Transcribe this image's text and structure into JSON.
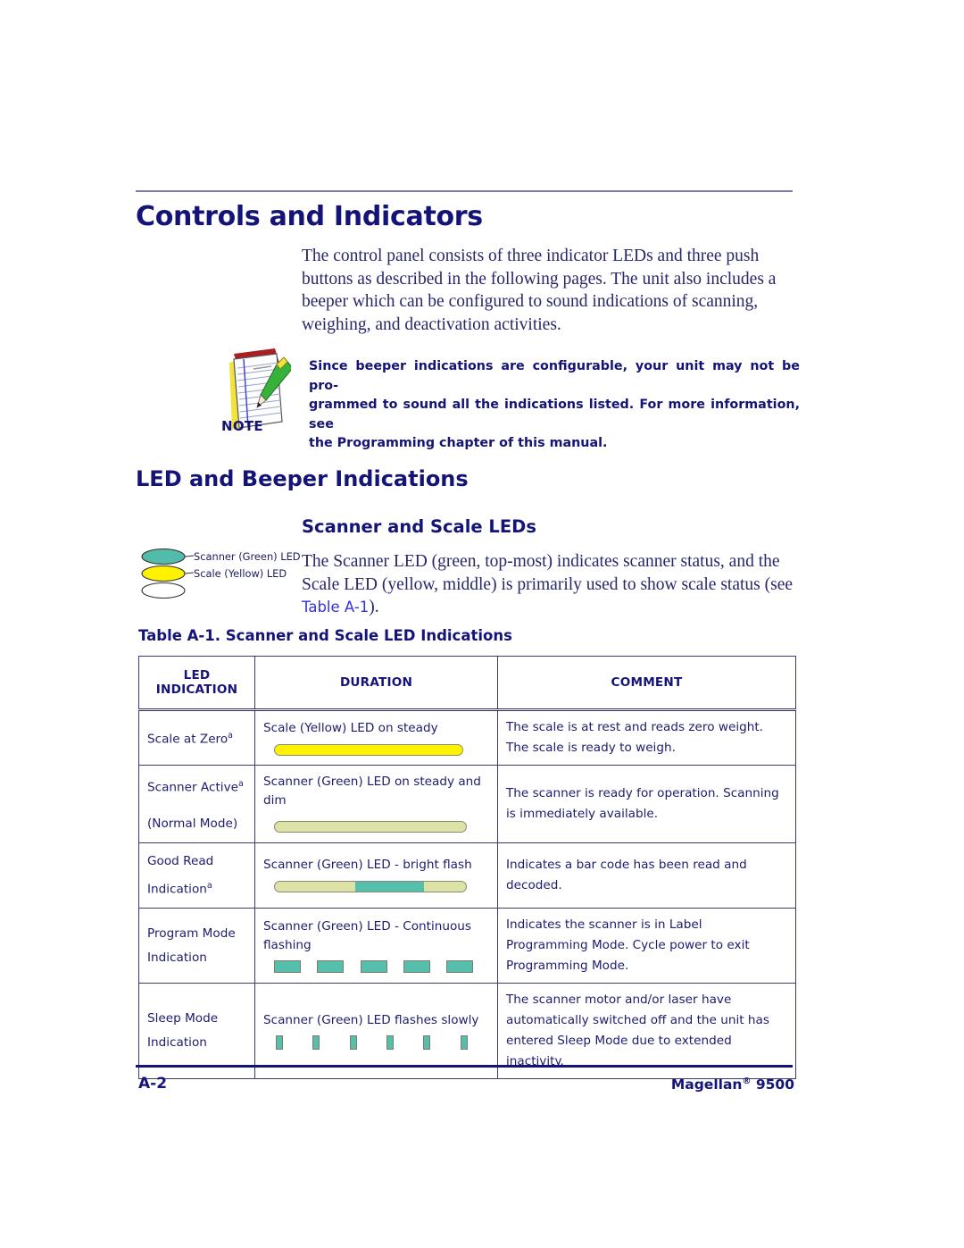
{
  "page": {
    "heading": "Controls and Indicators",
    "intro_paragraph": "The control panel consists of three indicator LEDs and three push buttons as described in the following pages. The unit also includes a beeper which can be configured to sound indications of scanning, weighing, and deactivation activities.",
    "rule_color": "#7a7ab0",
    "heading_color": "#141478"
  },
  "note": {
    "label": "NOTE",
    "icon": "notepad-pencil-icon",
    "line1": "Since beeper indications are configurable, your unit may not be pro-",
    "line2": "grammed to sound all the indications listed. For more information, see",
    "line3": "the Programming  chapter of this manual."
  },
  "sections": {
    "h2": "LED and Beeper Indications",
    "h3": "Scanner and Scale LEDs",
    "paragraph_part1": "The Scanner LED (green, top-most) indicates scanner status, and the Scale LED (yellow, middle) is primarily used to show scale status (see ",
    "paragraph_link": "Table A-1",
    "paragraph_part2": ")."
  },
  "led_figure": {
    "leds": [
      {
        "name": "scanner-green-led",
        "label": "Scanner (Green) LED",
        "color": "#52bba9"
      },
      {
        "name": "scale-yellow-led",
        "label": "Scale (Yellow) LED",
        "color": "#fff200"
      },
      {
        "name": "third-led",
        "label": "",
        "color": "#ffffff"
      }
    ]
  },
  "table": {
    "caption": "Table A-1. Scanner and Scale LED Indications",
    "headers": [
      "LED INDICATION",
      "DURATION",
      "COMMENT"
    ],
    "header_line1": "LED",
    "header_line2": "INDICATION",
    "rows": [
      {
        "led_line1": "Scale at Zero",
        "led_footnote": "a",
        "led_line2": "",
        "duration": "Scale (Yellow) LED on steady",
        "graphic": "bar-yellow",
        "comment": "The scale is at rest and reads zero weight. The scale is ready to weigh."
      },
      {
        "led_line1": "Scanner Active",
        "led_footnote": "a",
        "led_line2": "(Normal Mode)",
        "duration": "Scanner (Green) LED on steady and dim",
        "graphic": "bar-dim",
        "comment": "The scanner is ready for operation. Scanning is immediately available."
      },
      {
        "led_line1": "Good Read",
        "led_footnote": "a",
        "led_line2": "Indication",
        "duration": "Scanner (Green) LED - bright flash",
        "graphic": "bar-flash",
        "comment": "Indicates a bar code has been read and decoded."
      },
      {
        "led_line1": "Program Mode",
        "led_footnote": "",
        "led_line2": "Indication",
        "duration": "Scanner (Green) LED - Continuous flashing",
        "graphic": "blocks-5",
        "comment": "Indicates the scanner is in Label Programming Mode. Cycle power to exit Programming Mode."
      },
      {
        "led_line1": "Sleep Mode",
        "led_footnote": "",
        "led_line2": "Indication",
        "duration": "Scanner (Green) LED flashes slowly",
        "graphic": "dots-6",
        "comment": "The scanner motor and/or laser have automatically switched off and the unit has entered Sleep Mode due to extended inactivity."
      }
    ]
  },
  "footer": {
    "page_number": "A-2",
    "product": "Magellan",
    "registered": "®",
    "model": " 9500"
  },
  "colors": {
    "led_green": "#56bfac",
    "led_yellow": "#fff200",
    "led_dim": "#dde3a6",
    "text_navy": "#141478",
    "link_blue": "#3333dd"
  }
}
